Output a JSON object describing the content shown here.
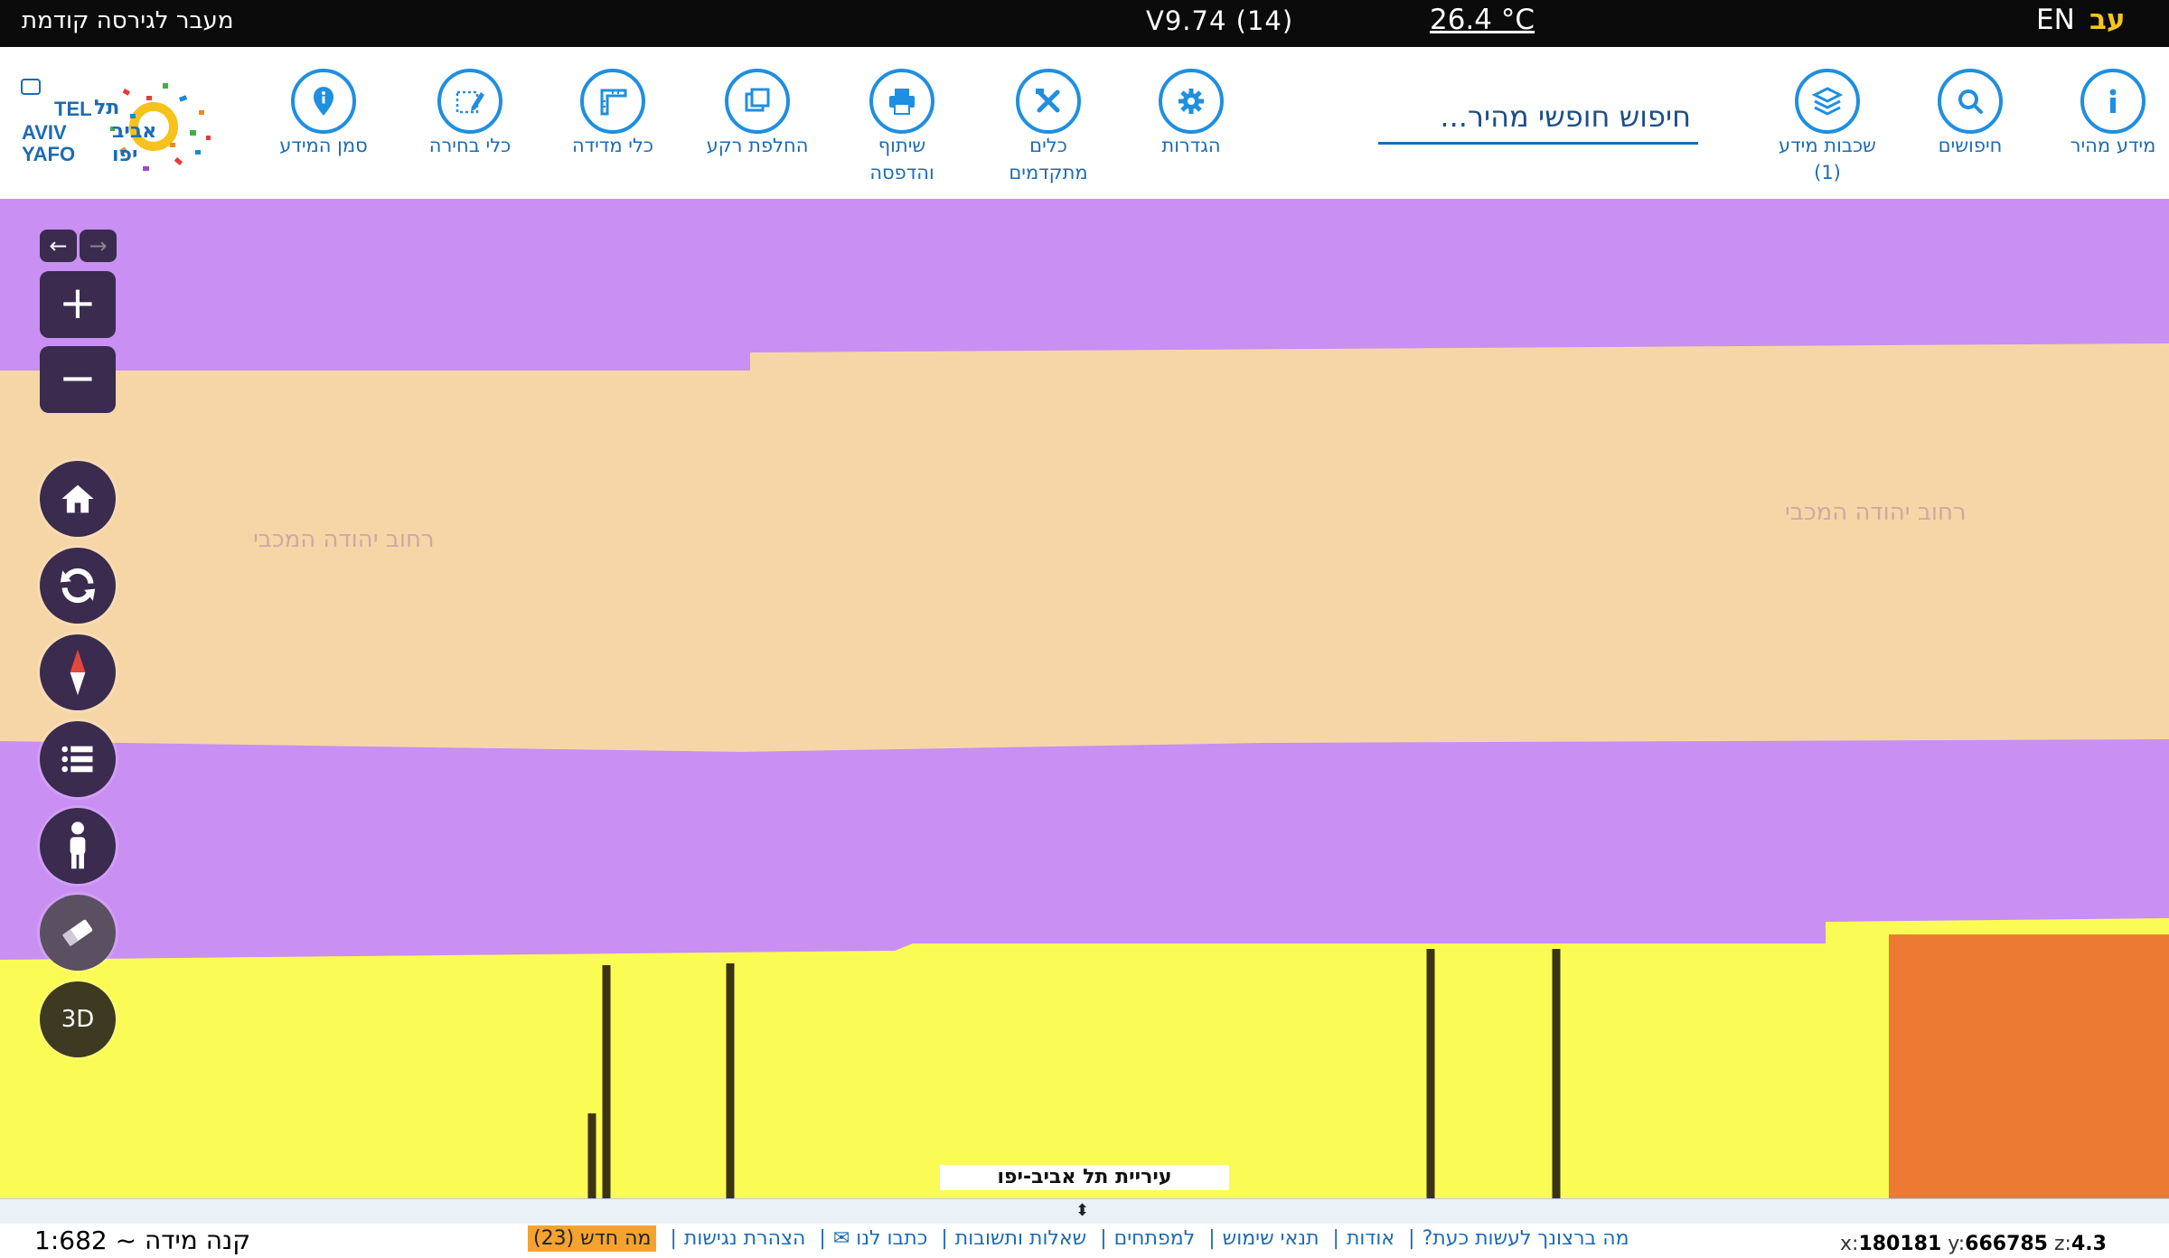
{
  "topbar": {
    "prev_version": "מעבר לגירסה קודמת",
    "version": "V9.74 (14)",
    "temperature": "26.4 °C",
    "lang_en": "EN",
    "lang_he": "עב"
  },
  "toolbar": {
    "search_placeholder": "חיפוש חופשי מהיר...",
    "items": [
      {
        "label": "מידע מהיר",
        "icon": "info-icon"
      },
      {
        "label": "חיפושים",
        "icon": "search-icon"
      },
      {
        "label": "שכבות מידע\n(1)",
        "icon": "layers-icon"
      },
      {
        "label": "הגדרות",
        "icon": "gear-icon"
      },
      {
        "label": "כלים\nמתקדמים",
        "icon": "tools-icon"
      },
      {
        "label": "שיתוף\nוהדפסה",
        "icon": "print-icon"
      },
      {
        "label": "החלפת רקע",
        "icon": "background-swap-icon"
      },
      {
        "label": "כלי מדידה",
        "icon": "ruler-icon"
      },
      {
        "label": "כלי בחירה",
        "icon": "select-pen-icon"
      },
      {
        "label": "סמן המידע",
        "icon": "map-pin-icon"
      }
    ],
    "logo": {
      "line1": "TEL",
      "line2": "AVIV",
      "line3": "YAFO",
      "he1": "תל",
      "he2": "אביב",
      "he3": "יפו"
    }
  },
  "map": {
    "big_street_label": "ה המכבי",
    "faint_labels": [
      "רחוב יהודה המכבי",
      "רחוב יהודה המכבי"
    ],
    "city_label": "עיריית תל אביב-יפו",
    "controls": {
      "back_arrow": "←",
      "forward_arrow": "→",
      "zoom_in": "+",
      "zoom_out": "−",
      "three_d": "3D"
    },
    "colors": {
      "purple": "#c98ff2",
      "beige": "#f6d6a6",
      "yellow": "#fbfb55",
      "orange": "#ed7a32",
      "control_bg": "#3a2b4f",
      "accent_blue": "#1f8fe0"
    }
  },
  "bottom": {
    "scale": "קנה מידה ~ 1:682",
    "links": [
      "מה ברצונך לעשות כעת?",
      "אודות",
      "תנאי שימוש",
      "למפתחים",
      "שאלות ותשובות",
      "כתבו לנו ✉",
      "הצהרת נגישות"
    ],
    "whats_new": "מה חדש (23)",
    "coords": {
      "x_label": "x:",
      "x": "180181",
      "y_label": "y:",
      "y": "666785",
      "z_label": "z:",
      "z": "4.3"
    }
  }
}
